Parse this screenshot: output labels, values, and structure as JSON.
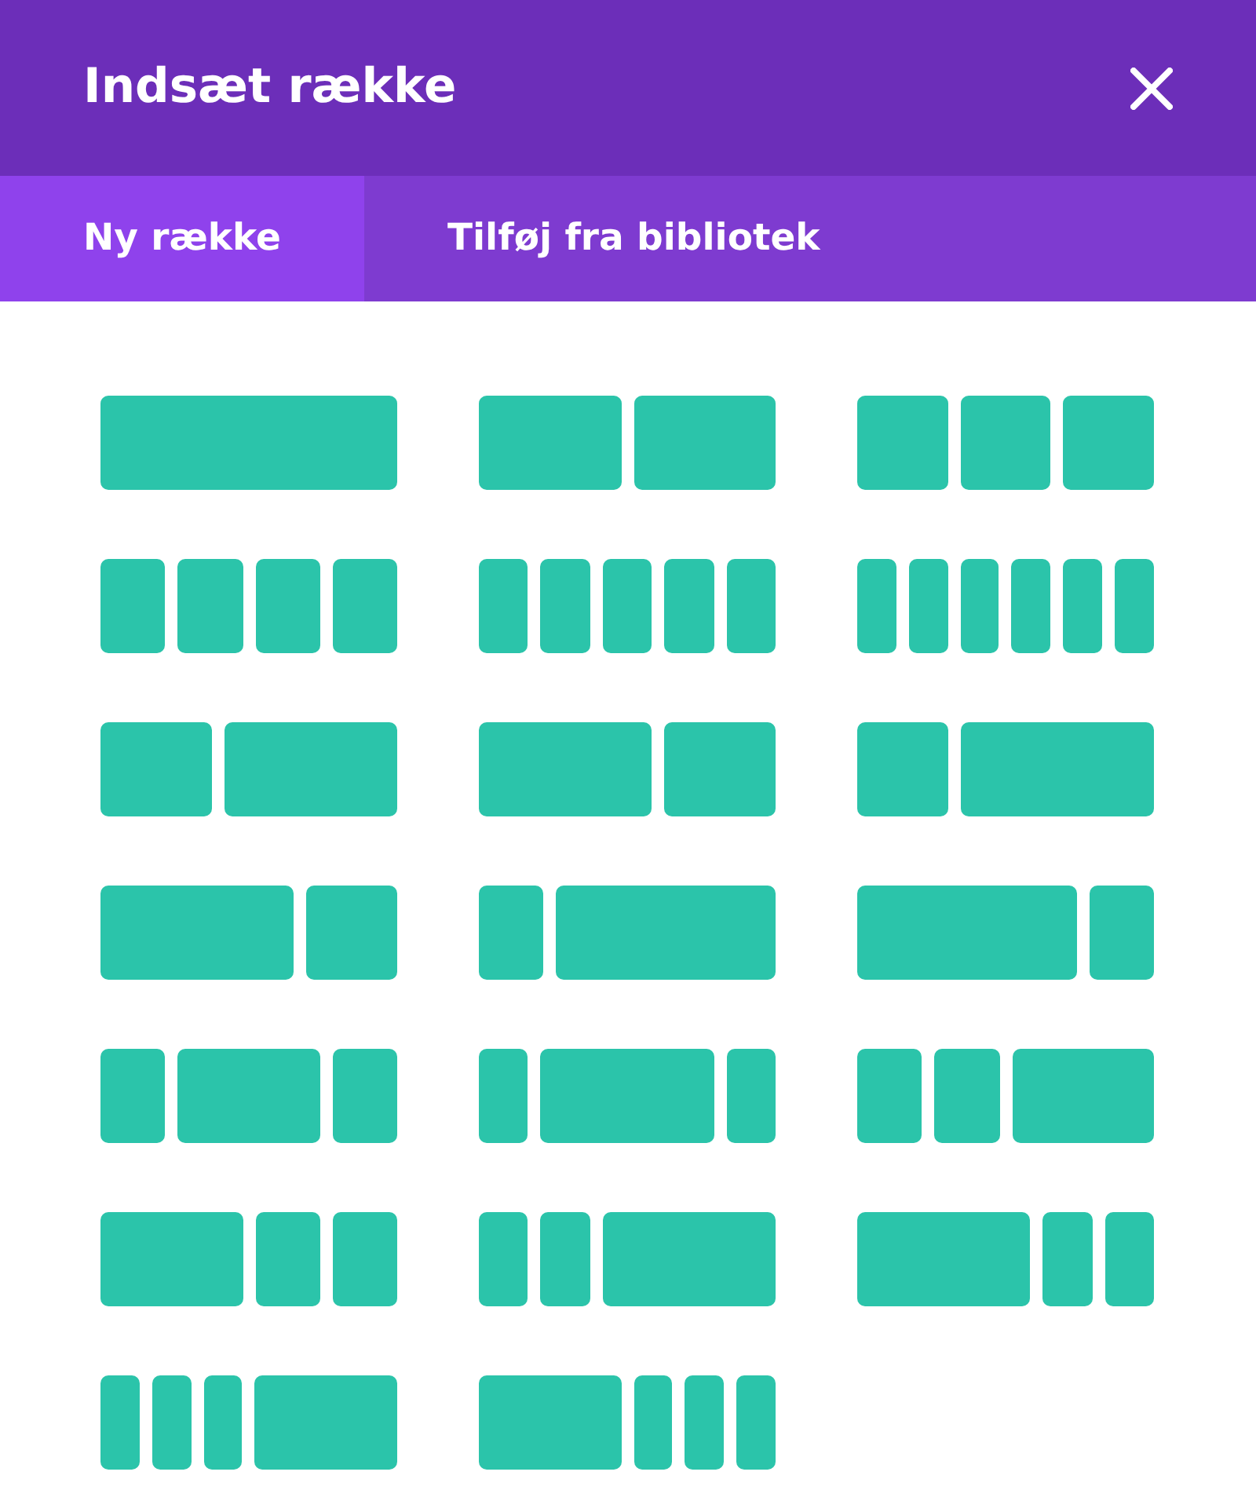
{
  "header": {
    "title": "Indsæt række"
  },
  "tabs": [
    {
      "label": "Ny række",
      "selected": true
    },
    {
      "label": "Tilføj fra bibliotek",
      "selected": false
    }
  ],
  "layouts": [
    {
      "columns": [
        {
          "kind": "full"
        }
      ]
    },
    {
      "columns": [
        {
          "kind": "half"
        },
        {
          "kind": "half"
        }
      ]
    },
    {
      "columns": [
        {
          "kind": "third"
        },
        {
          "kind": "third"
        },
        {
          "kind": "third"
        }
      ]
    },
    {
      "columns": [
        {
          "kind": "quarter"
        },
        {
          "kind": "quarter"
        },
        {
          "kind": "quarter"
        },
        {
          "kind": "quarter"
        }
      ]
    },
    {
      "columns": [
        {
          "kind": "fifth"
        },
        {
          "kind": "fifth"
        },
        {
          "kind": "fifth"
        },
        {
          "kind": "fifth"
        },
        {
          "kind": "fifth"
        }
      ]
    },
    {
      "columns": [
        {
          "kind": "sixth"
        },
        {
          "kind": "sixth"
        },
        {
          "kind": "sixth"
        },
        {
          "kind": "sixth"
        },
        {
          "kind": "sixth"
        },
        {
          "kind": "sixth"
        }
      ]
    },
    {
      "columns": [
        {
          "kind": "twofifths"
        },
        {
          "kind": "threefifths"
        }
      ]
    },
    {
      "columns": [
        {
          "kind": "threefifths"
        },
        {
          "kind": "twofifths"
        }
      ]
    },
    {
      "columns": [
        {
          "kind": "third"
        },
        {
          "kind": "twothirds"
        }
      ]
    },
    {
      "columns": [
        {
          "kind": "twothirds"
        },
        {
          "kind": "third"
        }
      ]
    },
    {
      "columns": [
        {
          "kind": "quarter"
        },
        {
          "kind": "threequarters"
        }
      ]
    },
    {
      "columns": [
        {
          "kind": "threequarters"
        },
        {
          "kind": "quarter"
        }
      ]
    },
    {
      "columns": [
        {
          "kind": "quarter"
        },
        {
          "kind": "half"
        },
        {
          "kind": "quarter"
        }
      ]
    },
    {
      "columns": [
        {
          "kind": "fifth"
        },
        {
          "kind": "threefifths"
        },
        {
          "kind": "fifth"
        }
      ]
    },
    {
      "columns": [
        {
          "kind": "quarter"
        },
        {
          "kind": "quarter"
        },
        {
          "kind": "half"
        }
      ]
    },
    {
      "columns": [
        {
          "kind": "half"
        },
        {
          "kind": "quarter"
        },
        {
          "kind": "quarter"
        }
      ]
    },
    {
      "columns": [
        {
          "kind": "fifth"
        },
        {
          "kind": "fifth"
        },
        {
          "kind": "threefifths"
        }
      ]
    },
    {
      "columns": [
        {
          "kind": "threefifths"
        },
        {
          "kind": "fifth"
        },
        {
          "kind": "fifth"
        }
      ]
    },
    {
      "columns": [
        {
          "kind": "sixth"
        },
        {
          "kind": "sixth"
        },
        {
          "kind": "sixth"
        },
        {
          "kind": "half"
        }
      ]
    },
    {
      "columns": [
        {
          "kind": "half"
        },
        {
          "kind": "sixth"
        },
        {
          "kind": "sixth"
        },
        {
          "kind": "sixth"
        }
      ]
    }
  ]
}
